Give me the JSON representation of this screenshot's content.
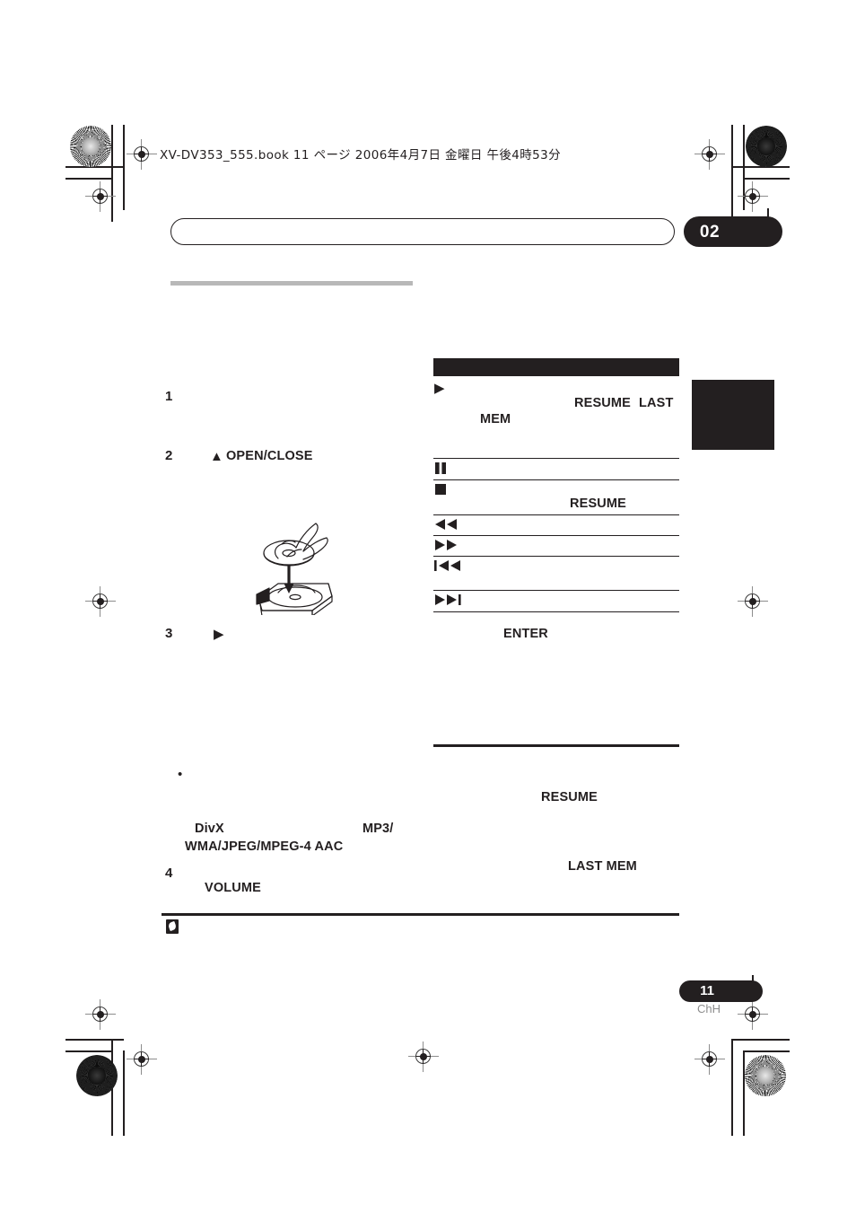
{
  "print_header": {
    "text": "XV-DV353_555.book 11 ページ 2006年4月7日 金曜日 午後4時53分"
  },
  "chapter": {
    "number": "02",
    "title": ""
  },
  "left_column": {
    "steps": [
      {
        "number": "1",
        "bold_runs": []
      },
      {
        "number": "2",
        "bold_runs": [
          {
            "icon": "eject-icon",
            "glyph": "▲",
            "label": "OPEN/CLOSE"
          }
        ]
      },
      {
        "number": "3",
        "bold_runs": [
          {
            "icon": "play-icon",
            "glyph": "▶",
            "label": ""
          }
        ]
      },
      {
        "number": "4",
        "bold_runs": [
          {
            "icon": "",
            "glyph": "",
            "label": "VOLUME"
          }
        ]
      }
    ],
    "illustration": {
      "name": "disc-loading-illustration",
      "caption": "Hand placing a disc onto an open disc tray"
    },
    "bullet_note": {
      "marker": "•",
      "terms": [
        "DivX",
        "MP3/",
        "WMA/JPEG/MPEG-4 AAC"
      ]
    },
    "note_block": {
      "icon": "memo-note-icon"
    }
  },
  "right_column": {
    "table_title": "",
    "rows": [
      {
        "icon_name": "play-icon",
        "glyph": "▶",
        "terms": [
          "RESUME",
          "LAST",
          "MEM"
        ]
      },
      {
        "icon_name": "pause-icon",
        "glyph": "▐▌",
        "terms": []
      },
      {
        "icon_name": "stop-icon",
        "glyph": "■",
        "terms": [
          "RESUME"
        ]
      },
      {
        "icon_name": "rewind-icon",
        "glyph": "◀◀",
        "terms": []
      },
      {
        "icon_name": "fast-forward-icon",
        "glyph": "▶▶",
        "terms": []
      },
      {
        "icon_name": "previous-track-icon",
        "glyph": "❙◀◀",
        "terms": []
      },
      {
        "icon_name": "next-track-icon",
        "glyph": "▶▶❙",
        "terms": []
      }
    ],
    "enter_label": "ENTER",
    "lower_section": {
      "terms": [
        "RESUME",
        "LAST MEM"
      ]
    }
  },
  "footer": {
    "page_number": "11",
    "language_code": "ChH"
  }
}
